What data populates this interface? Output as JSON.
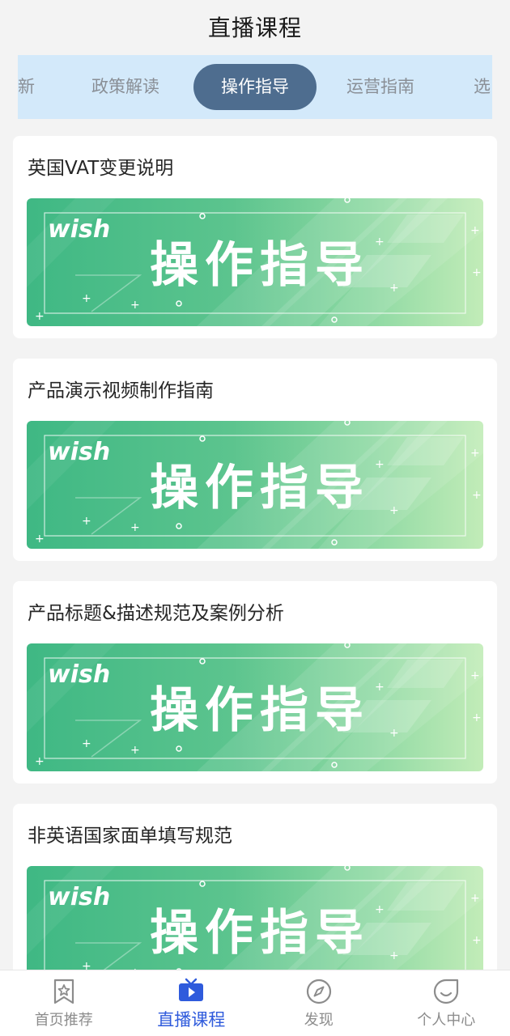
{
  "header": {
    "title": "直播课程"
  },
  "tabs": {
    "items": [
      {
        "label": "新"
      },
      {
        "label": "政策解读"
      },
      {
        "label": "操作指导"
      },
      {
        "label": "运营指南"
      },
      {
        "label": "选"
      }
    ],
    "active_index": 2,
    "active_bg": "#4e6d8f",
    "bar_bg": "#d3e9fa"
  },
  "courses": [
    {
      "title": "英国VAT变更说明",
      "banner": {
        "brand": "wish",
        "text": "操作指导"
      }
    },
    {
      "title": "产品演示视频制作指南",
      "banner": {
        "brand": "wish",
        "text": "操作指导"
      }
    },
    {
      "title": "产品标题&描述规范及案例分析",
      "banner": {
        "brand": "wish",
        "text": "操作指导"
      }
    },
    {
      "title": "非英语国家面单填写规范",
      "banner": {
        "brand": "wish",
        "text": "操作指导"
      }
    }
  ],
  "bottom_nav": {
    "items": [
      {
        "label": "首页推荐",
        "icon": "bookmark-star-icon"
      },
      {
        "label": "直播课程",
        "icon": "tv-play-icon"
      },
      {
        "label": "发现",
        "icon": "compass-icon"
      },
      {
        "label": "个人中心",
        "icon": "smile-face-icon"
      }
    ],
    "active_index": 1,
    "active_color": "#2f5bdc"
  }
}
